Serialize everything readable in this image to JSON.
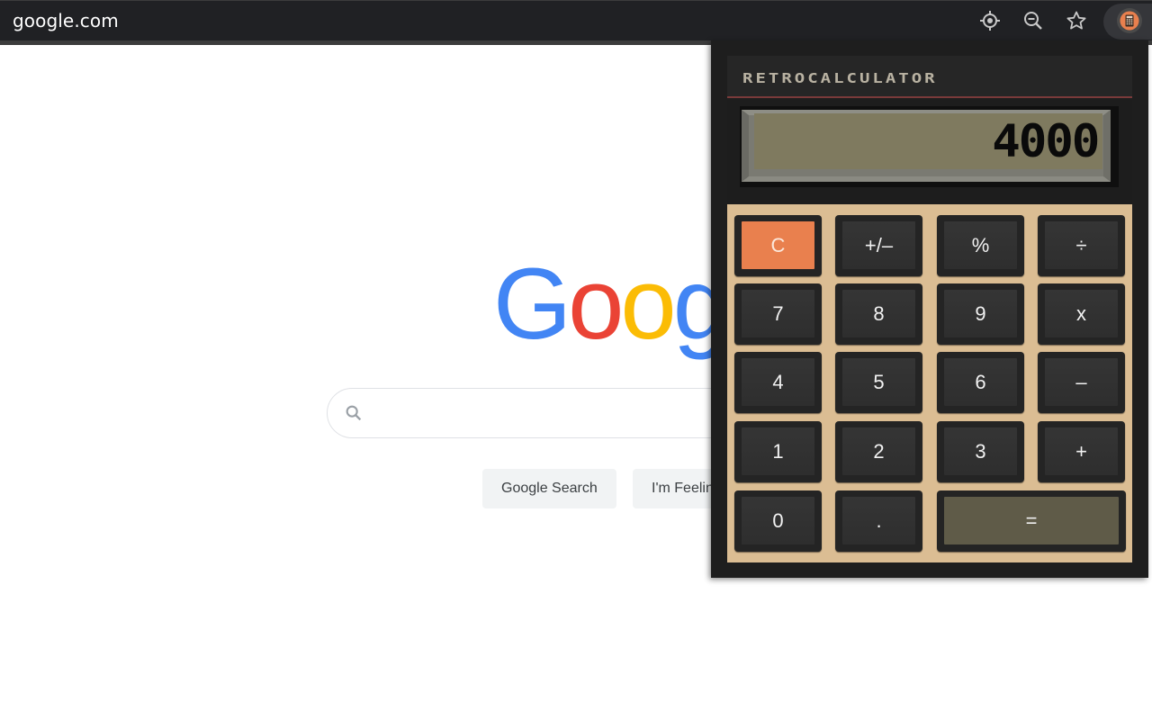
{
  "browser": {
    "url": "google.com",
    "toolbar_icons": [
      {
        "name": "location-icon"
      },
      {
        "name": "zoom-out-icon"
      },
      {
        "name": "bookmark-star-icon"
      },
      {
        "name": "calculator-extension-icon"
      }
    ]
  },
  "google": {
    "logo_letters": [
      {
        "char": "G",
        "color": "#4285f4"
      },
      {
        "char": "o",
        "color": "#ea4335"
      },
      {
        "char": "o",
        "color": "#fbbc05"
      },
      {
        "char": "g",
        "color": "#4285f4"
      }
    ],
    "search_value": "",
    "buttons": {
      "search": "Google Search",
      "lucky": "I'm Feeling Lucky"
    }
  },
  "calculator": {
    "title": "RETROCALCULATOR",
    "display": "4000",
    "colors": {
      "keypad_bg": "#dbbd93",
      "clear_key": "#e9804e",
      "equals_key": "#5f5b48",
      "screen": "#7f7a5f"
    },
    "keys": [
      {
        "label": "C",
        "kind": "clear"
      },
      {
        "label": "+/–",
        "kind": "func"
      },
      {
        "label": "%",
        "kind": "func"
      },
      {
        "label": "÷",
        "kind": "op"
      },
      {
        "label": "7",
        "kind": "digit"
      },
      {
        "label": "8",
        "kind": "digit"
      },
      {
        "label": "9",
        "kind": "digit"
      },
      {
        "label": "x",
        "kind": "op"
      },
      {
        "label": "4",
        "kind": "digit"
      },
      {
        "label": "5",
        "kind": "digit"
      },
      {
        "label": "6",
        "kind": "digit"
      },
      {
        "label": "–",
        "kind": "op"
      },
      {
        "label": "1",
        "kind": "digit"
      },
      {
        "label": "2",
        "kind": "digit"
      },
      {
        "label": "3",
        "kind": "digit"
      },
      {
        "label": "+",
        "kind": "op"
      },
      {
        "label": "0",
        "kind": "digit"
      },
      {
        "label": ".",
        "kind": "decimal"
      },
      {
        "label": "=",
        "kind": "equals"
      }
    ]
  }
}
